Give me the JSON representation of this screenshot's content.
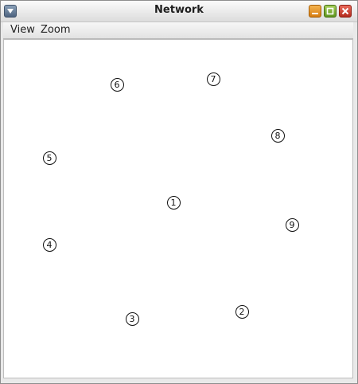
{
  "window": {
    "title": "Network"
  },
  "menubar": {
    "items": [
      {
        "label": "View"
      },
      {
        "label": "Zoom"
      }
    ]
  },
  "graph": {
    "nodes": [
      {
        "id": "1",
        "label": "1"
      },
      {
        "id": "2",
        "label": "2"
      },
      {
        "id": "3",
        "label": "3"
      },
      {
        "id": "4",
        "label": "4"
      },
      {
        "id": "5",
        "label": "5"
      },
      {
        "id": "6",
        "label": "6"
      },
      {
        "id": "7",
        "label": "7"
      },
      {
        "id": "8",
        "label": "8"
      },
      {
        "id": "9",
        "label": "9"
      }
    ]
  },
  "icons": {
    "system_menu": "chevron-down-icon",
    "minimize": "minimize-icon",
    "maximize": "maximize-icon",
    "close": "close-icon"
  },
  "colors": {
    "minimize_button": "#e0952d",
    "maximize_button": "#7fb23a",
    "close_button": "#d0473a",
    "canvas_background": "#ffffff"
  }
}
